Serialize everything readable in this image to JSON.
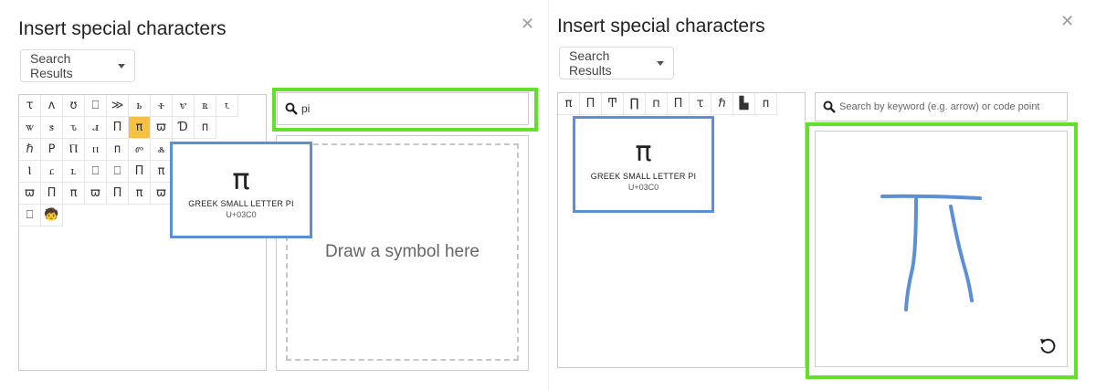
{
  "left": {
    "title": "Insert special characters",
    "dropdown_label": "Search Results",
    "search_value": "pi",
    "grid_rows": [
      [
        "ꚍ",
        "ʌ",
        "ʊ",
        "⎕",
        "≫",
        "ꮟ",
        "ꮠ",
        "ꮡ",
        "ꮢ",
        "ꮣ"
      ],
      [
        "ꮤ",
        "ꮥ",
        "ꮦ",
        "ꮧ",
        "Π",
        "π",
        "ϖ",
        "Ɗ",
        "ᴨ"
      ],
      [
        "ℏ",
        "ꓑ",
        "Ⲡ",
        "ⲡ",
        "ᴨ",
        "ꮫ",
        "ꮬ"
      ],
      [
        "Ⲓ",
        "ꮭ",
        "ꮮ",
        "⎕",
        "⎕",
        "Π",
        "π"
      ],
      [
        "ϖ",
        "Π",
        "π",
        "ϖ",
        "Π",
        "π",
        "ϖ"
      ],
      [
        "⎕",
        "🧒"
      ]
    ],
    "highlight": "π",
    "preview": {
      "glyph": "π",
      "name": "GREEK SMALL LETTER PI",
      "code": "U+03C0"
    },
    "draw_hint": "Draw a symbol here",
    "search_icon": "search-icon",
    "close_icon": "close-icon"
  },
  "right": {
    "title": "Insert special characters",
    "dropdown_label": "Search Results",
    "search_placeholder": "Search by keyword (e.g. arrow) or code point",
    "results": [
      "π",
      "Π",
      "Ͳ",
      "∏",
      "п",
      "Π",
      "ꚍ",
      "ℏ",
      "▙",
      "ᴨ"
    ],
    "preview": {
      "glyph": "π",
      "name": "GREEK SMALL LETTER PI",
      "code": "U+03C0"
    },
    "refresh_icon": "refresh-icon"
  },
  "colors": {
    "highlight": "#f6c142",
    "green_box": "#62e02a",
    "blue_box": "#5b8fd6",
    "stroke": "#5b8fd6"
  }
}
